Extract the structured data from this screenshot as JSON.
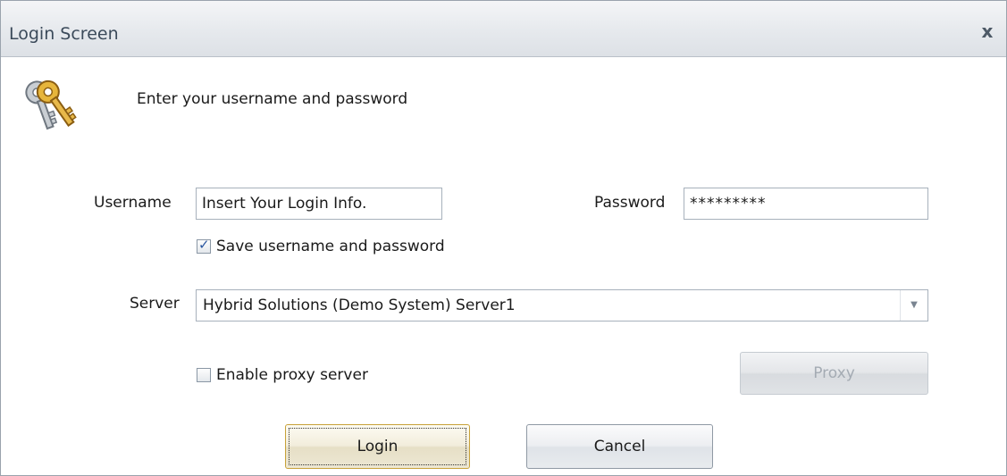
{
  "window": {
    "title": "Login Screen",
    "close_glyph": "x"
  },
  "header": {
    "icon": "keys-icon",
    "prompt": "Enter your username and password"
  },
  "form": {
    "username": {
      "label": "Username",
      "value": "Insert Your Login Info."
    },
    "password": {
      "label": "Password",
      "value": "*********"
    },
    "save_credentials": {
      "label": "Save username and password",
      "checked": true
    },
    "server": {
      "label": "Server",
      "selected": "Hybrid Solutions (Demo System) Server1"
    },
    "proxy": {
      "label": "Enable proxy server",
      "checked": false,
      "button_label": "Proxy"
    }
  },
  "actions": {
    "login_label": "Login",
    "cancel_label": "Cancel"
  },
  "colors": {
    "titlebar": "#e6e9ed",
    "title_text": "#3b4a5a",
    "default_button_border": "#c8a23a",
    "check_mark": "#2a56a0"
  }
}
